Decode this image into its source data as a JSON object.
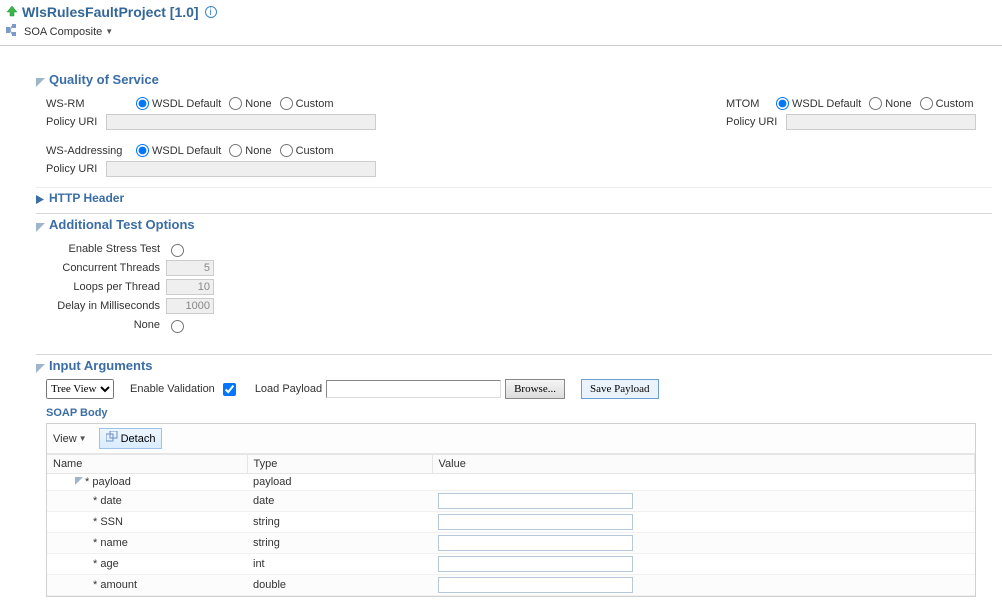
{
  "header": {
    "title": "WlsRulesFaultProject [1.0]",
    "info_tooltip": "i"
  },
  "breadcrumb": {
    "label": "SOA Composite"
  },
  "qos": {
    "title": "Quality of Service",
    "wsrm_label": "WS-RM",
    "mtom_label": "MTOM",
    "wsaddr_label": "WS-Addressing",
    "policy_label": "Policy URI",
    "options": {
      "wsdl_default": "WSDL Default",
      "none": "None",
      "custom": "Custom"
    },
    "wsrm_selected": "wsdl_default",
    "mtom_selected": "wsdl_default",
    "wsaddr_selected": "wsdl_default",
    "http_header": "HTTP Header"
  },
  "stress": {
    "title": "Additional Test Options",
    "enable_label": "Enable Stress Test",
    "concurrent_label": "Concurrent Threads",
    "concurrent_value": "5",
    "loops_label": "Loops per Thread",
    "loops_value": "10",
    "delay_label": "Delay in Milliseconds",
    "delay_value": "1000",
    "none_label": "None"
  },
  "inputargs": {
    "title": "Input Arguments",
    "tree_view_label": "Tree View",
    "enable_validation_label": "Enable Validation",
    "enable_validation_checked": true,
    "load_payload_label": "Load Payload",
    "browse_label": "Browse...",
    "save_payload_label": "Save Payload",
    "soap_body_label": "SOAP Body",
    "view_label": "View",
    "detach_label": "Detach",
    "columns": {
      "name": "Name",
      "type": "Type",
      "value": "Value"
    },
    "rows": [
      {
        "name": "* payload",
        "type": "payload",
        "indent": 1,
        "expander": true,
        "editable": false
      },
      {
        "name": "* date",
        "type": "date",
        "indent": 2,
        "expander": false,
        "editable": true
      },
      {
        "name": "* SSN",
        "type": "string",
        "indent": 2,
        "expander": false,
        "editable": true
      },
      {
        "name": "* name",
        "type": "string",
        "indent": 2,
        "expander": false,
        "editable": true
      },
      {
        "name": "* age",
        "type": "int",
        "indent": 2,
        "expander": false,
        "editable": true
      },
      {
        "name": "* amount",
        "type": "double",
        "indent": 2,
        "expander": false,
        "editable": true
      }
    ]
  }
}
